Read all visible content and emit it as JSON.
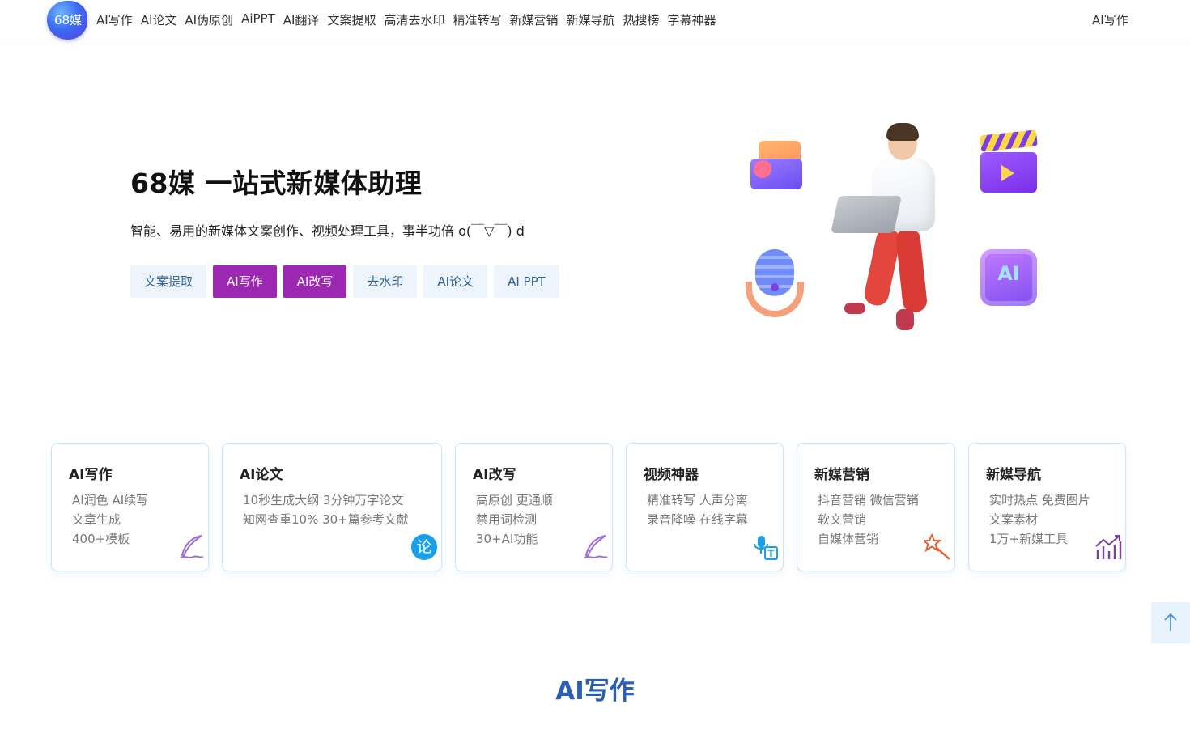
{
  "nav": {
    "logo_text": "68媒",
    "items": [
      "AI写作",
      "AI论文",
      "AI伪原创",
      "AiPPT",
      "AI翻译",
      "文案提取",
      "高清去水印",
      "精准转写",
      "新媒营销",
      "新媒导航",
      "热搜榜",
      "字幕神器"
    ],
    "right_link": "AI写作"
  },
  "hero": {
    "title": "68媒 一站式新媒体助理",
    "subtitle": "智能、易用的新媒体文案创作、视频处理工具，事半功倍 o(￣▽￣) d",
    "buttons": [
      {
        "label": "文案提取",
        "style": "light"
      },
      {
        "label": "AI写作",
        "style": "purple"
      },
      {
        "label": "AI改写",
        "style": "purple"
      },
      {
        "label": "去水印",
        "style": "light"
      },
      {
        "label": "AI论文",
        "style": "light"
      },
      {
        "label": "AI PPT",
        "style": "light"
      }
    ],
    "illustration_chip_text": "AI"
  },
  "cards": [
    {
      "title": "AI写作",
      "lines": [
        "AI润色  AI续写",
        "文章生成",
        "400+模板"
      ],
      "icon": "quill-icon",
      "icon_color": "#9b6fd6"
    },
    {
      "title": "AI论文",
      "lines": [
        "10秒生成大纲  3分钟万字论文",
        "知网查重10%  30+篇参考文献"
      ],
      "icon": "thesis-icon",
      "icon_text": "论",
      "icon_color": "#1aa0e8"
    },
    {
      "title": "AI改写",
      "lines": [
        "高原创  更通顺",
        "禁用词检测",
        "30+AI功能"
      ],
      "icon": "quill-icon",
      "icon_color": "#9b6fd6"
    },
    {
      "title": "视频神器",
      "lines": [
        "精准转写  人声分离",
        "录音降噪  在线字幕"
      ],
      "icon": "speech-to-text-icon",
      "icon_color": "#1aa0e8"
    },
    {
      "title": "新媒营销",
      "lines": [
        "抖音营销  微信营销",
        "软文营销",
        "自媒体营销"
      ],
      "icon": "magic-wand-icon",
      "icon_color": "#e8562a"
    },
    {
      "title": "新媒导航",
      "lines": [
        "实时热点  免费图片",
        "文案素材",
        "1万+新媒工具"
      ],
      "icon": "growth-chart-icon",
      "icon_color": "#7a3fa0"
    }
  ],
  "section_title": "AI写作",
  "colors": {
    "accent_purple": "#9c27b0",
    "light_button": "#eef4fb",
    "section_title": "#2a5fb4",
    "card_border": "#cfe3f5"
  }
}
